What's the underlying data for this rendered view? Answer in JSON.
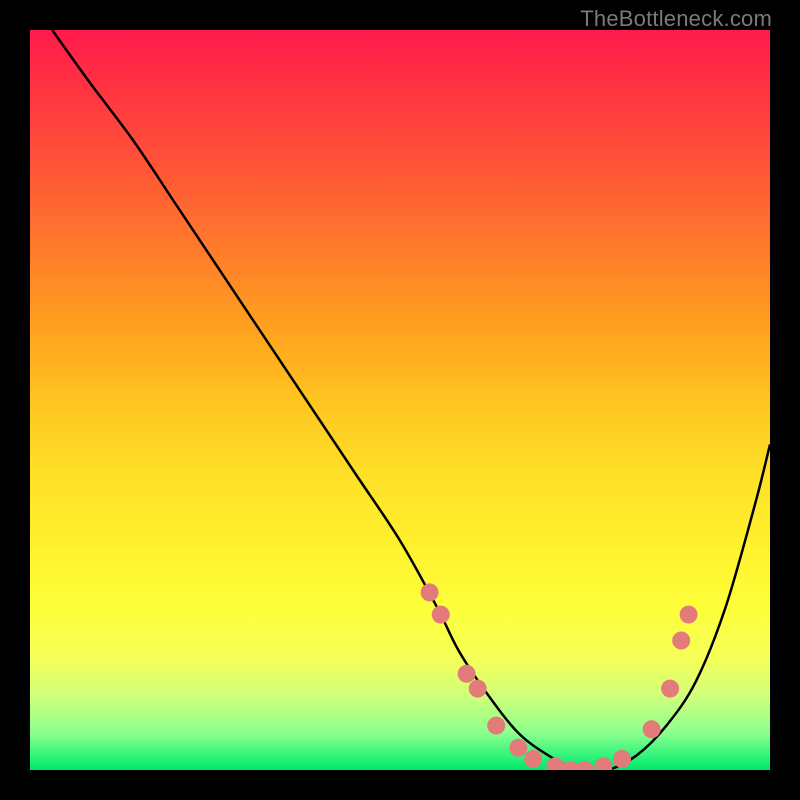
{
  "watermark": "TheBottleneck.com",
  "chart_data": {
    "type": "line",
    "title": "",
    "xlabel": "",
    "ylabel": "",
    "xlim": [
      0,
      100
    ],
    "ylim": [
      0,
      100
    ],
    "grid": false,
    "legend": false,
    "background_gradient": {
      "top": "#ff1a4b",
      "mid": "#ffe028",
      "bottom": "#00e86a"
    },
    "series": [
      {
        "name": "bottleneck-curve",
        "color": "#000000",
        "x": [
          3,
          8,
          14,
          20,
          26,
          32,
          38,
          44,
          50,
          55,
          58,
          62,
          66,
          70,
          74,
          78,
          82,
          86,
          90,
          94,
          98,
          100
        ],
        "y": [
          100,
          93,
          85,
          76,
          67,
          58,
          49,
          40,
          31,
          22,
          16,
          10,
          5,
          2,
          0,
          0,
          2,
          6,
          12,
          22,
          36,
          44
        ]
      }
    ],
    "markers": {
      "color": "#e37b7b",
      "radius_px": 9,
      "points": [
        {
          "x": 54,
          "y": 24
        },
        {
          "x": 55.5,
          "y": 21
        },
        {
          "x": 59,
          "y": 13
        },
        {
          "x": 60.5,
          "y": 11
        },
        {
          "x": 63,
          "y": 6
        },
        {
          "x": 66,
          "y": 3
        },
        {
          "x": 68,
          "y": 1.5
        },
        {
          "x": 71,
          "y": 0.5
        },
        {
          "x": 73,
          "y": 0
        },
        {
          "x": 75,
          "y": 0
        },
        {
          "x": 77.5,
          "y": 0.5
        },
        {
          "x": 80,
          "y": 1.5
        },
        {
          "x": 84,
          "y": 5.5
        },
        {
          "x": 86.5,
          "y": 11
        },
        {
          "x": 88,
          "y": 17.5
        },
        {
          "x": 89,
          "y": 21
        }
      ]
    }
  }
}
